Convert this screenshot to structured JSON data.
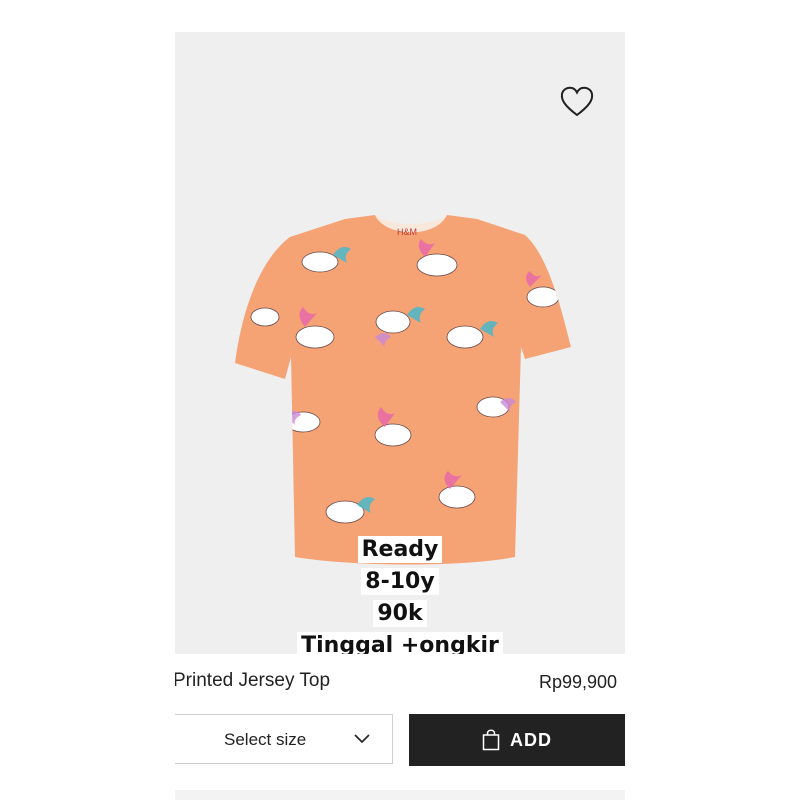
{
  "overlay": {
    "line1": "Ready",
    "line2": "8-10y",
    "line3": "90k",
    "line4": "Tinggal +ongkir"
  },
  "product": {
    "name": "Printed Jersey Top",
    "price": "Rp99,900",
    "brand_tag": "H&M"
  },
  "size_select": {
    "label": "Select size"
  },
  "add_button": {
    "label": "ADD"
  },
  "colors": {
    "shirt": "#f5a274",
    "background": "#efefef",
    "button": "#222222"
  },
  "icons": {
    "favorite": "heart-icon",
    "dropdown": "chevron-down-icon",
    "bag": "shopping-bag-icon"
  }
}
